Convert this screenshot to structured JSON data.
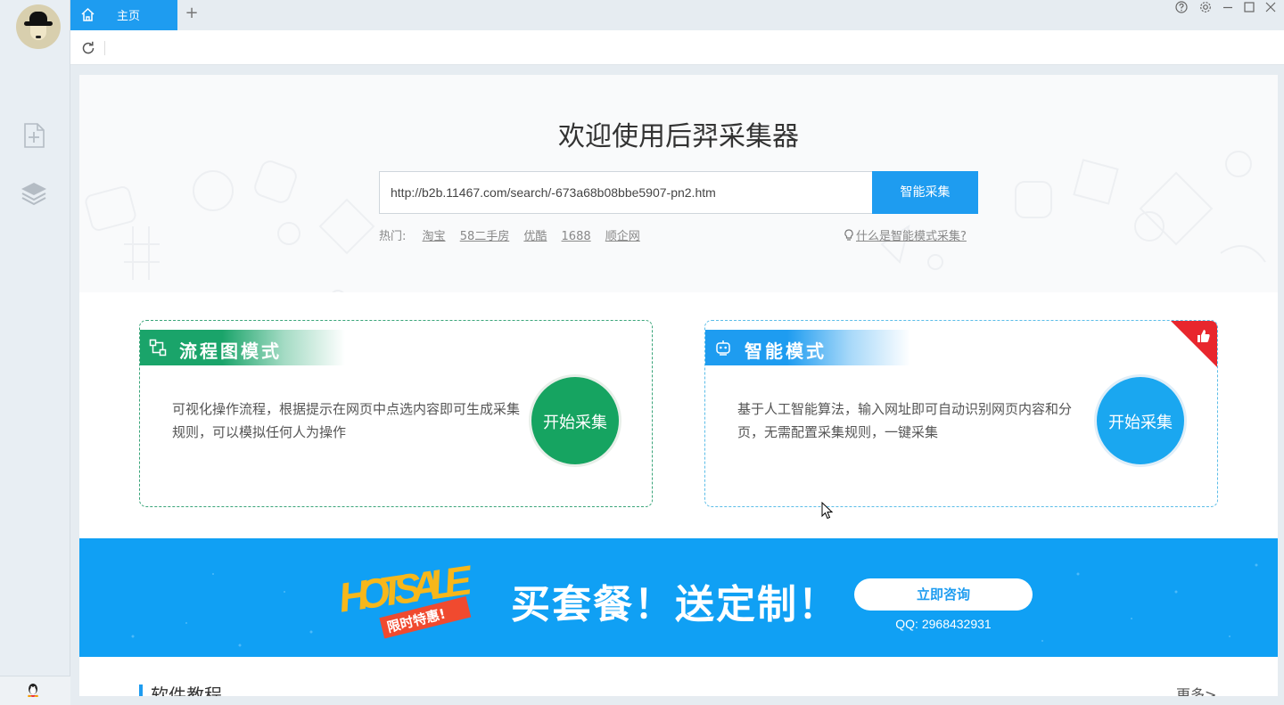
{
  "tab": {
    "label": "主页",
    "add": "+"
  },
  "hero": {
    "title": "欢迎使用后羿采集器",
    "url_value": "http://b2b.11467.com/search/-673a68b08bbe5907-pn2.htm",
    "search_button": "智能采集",
    "hot_label": "热门:",
    "hot_links": [
      "淘宝",
      "58二手房",
      "优酷",
      "1688",
      "顺企网"
    ],
    "help_link": "什么是智能模式采集?"
  },
  "flow_card": {
    "title": "流程图模式",
    "description": "可视化操作流程，根据提示在网页中点选内容即可生成采集规则，可以模拟任何人为操作",
    "button": "开始采集"
  },
  "smart_card": {
    "title": "智能模式",
    "description": "基于人工智能算法，输入网址即可自动识别网页内容和分页，无需配置采集规则，一键采集",
    "button": "开始采集"
  },
  "banner": {
    "logo_text": "HOTSALE",
    "logo_sub": "限时特惠!",
    "promo": "买套餐！送定制！",
    "consult_button": "立即咨询",
    "qq": "QQ: 2968432931"
  },
  "tutorial": {
    "title": "软件教程",
    "more": "更多>"
  },
  "colors": {
    "accent": "#1e9cf0",
    "flow_green": "#16a461",
    "banner_blue": "#10a0f4"
  },
  "icons": [
    "home-icon",
    "refresh-icon",
    "new-task-icon",
    "layers-icon",
    "qq-penguin-icon",
    "help-icon",
    "settings-icon",
    "minimize-icon",
    "maximize-icon",
    "close-icon",
    "bulb-icon",
    "flow-icon",
    "robot-icon",
    "thumbs-up-icon"
  ]
}
